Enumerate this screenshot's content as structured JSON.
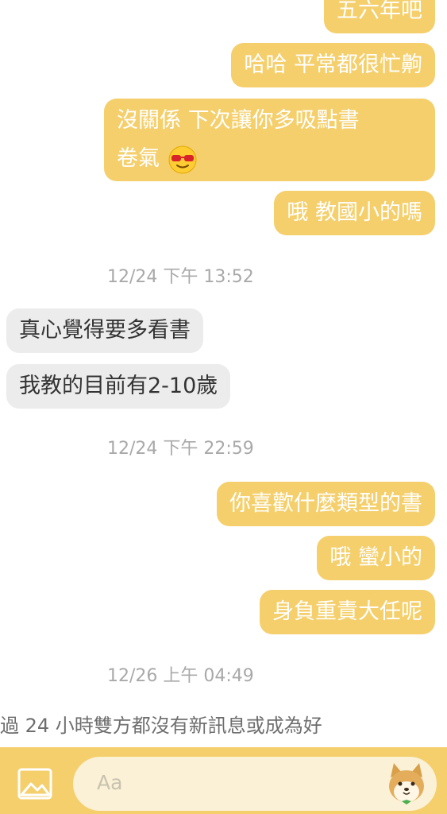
{
  "messages": [
    {
      "dir": "out",
      "text": "五六年吧"
    },
    {
      "dir": "out",
      "text": "哈哈 平常都很忙齁"
    },
    {
      "dir": "out",
      "line1": "沒關係 下次讓你多吸點書",
      "line2": "卷氣",
      "emoji": "sunglasses-emoji"
    },
    {
      "dir": "out",
      "text": "哦 教國小的嗎"
    },
    {
      "dir": "timestamp",
      "text": "12/24 下午 13:52"
    },
    {
      "dir": "in",
      "text": "真心覺得要多看書"
    },
    {
      "dir": "in",
      "text": "我教的目前有2-10歲"
    },
    {
      "dir": "timestamp",
      "text": "12/24 下午 22:59"
    },
    {
      "dir": "out",
      "text": "你喜歡什麼類型的書"
    },
    {
      "dir": "out",
      "text": "哦 蠻小的"
    },
    {
      "dir": "out",
      "text": "身負重責大任呢"
    },
    {
      "dir": "timestamp",
      "text": "12/26 上午 04:49"
    }
  ],
  "notice": "過 24 小時雙方都沒有新訊息或成為好",
  "input": {
    "placeholder": "Aa",
    "image_icon": "image-icon",
    "sticker_icon": "shiba-sticker-icon"
  },
  "colors": {
    "outgoing_bubble": "#f4cf6c",
    "incoming_bubble": "#ececec",
    "input_bar": "#f4cf6c"
  }
}
